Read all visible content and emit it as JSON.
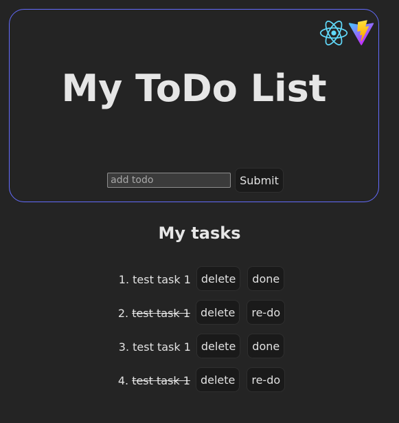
{
  "header": {
    "title": "My ToDo List",
    "logos": [
      "react-logo-icon",
      "vite-logo-icon"
    ]
  },
  "form": {
    "input_placeholder": "add todo",
    "input_value": "",
    "submit_label": "Submit"
  },
  "tasks": {
    "heading": "My tasks",
    "items": [
      {
        "index": "1.",
        "text": "test task 1",
        "done": false,
        "delete_label": "delete",
        "toggle_label": "done"
      },
      {
        "index": "2.",
        "text": "test task 1",
        "done": true,
        "delete_label": "delete",
        "toggle_label": "re-do"
      },
      {
        "index": "3.",
        "text": "test task 1",
        "done": false,
        "delete_label": "delete",
        "toggle_label": "done"
      },
      {
        "index": "4.",
        "text": "test task 1",
        "done": true,
        "delete_label": "delete",
        "toggle_label": "re-do"
      }
    ]
  },
  "colors": {
    "background": "#242424",
    "card_border": "#646cff",
    "button_bg": "#1a1a1a",
    "react_blue": "#61dafb",
    "vite_purple": "#bd34fe",
    "vite_yellow": "#ffd62e"
  }
}
